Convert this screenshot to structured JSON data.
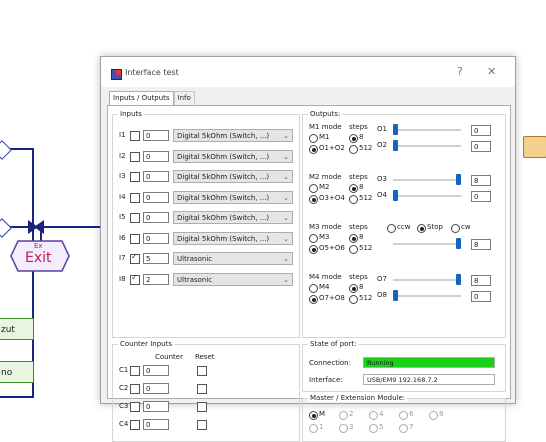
{
  "flow": {
    "exit_small": "Ex",
    "exit_label": "Exit",
    "box1": "zut",
    "box2": "no"
  },
  "window": {
    "title": "Interface test",
    "help": "?",
    "close": "✕"
  },
  "tabs": [
    {
      "label": "Inputs / Outputs"
    },
    {
      "label": "Info"
    }
  ],
  "inputs": {
    "group_label": "Inputs",
    "rows": [
      {
        "name": "I1",
        "checked": false,
        "value": "0",
        "mode": "Digital 5kOhm (Switch, ...)"
      },
      {
        "name": "I2",
        "checked": false,
        "value": "0",
        "mode": "Digital 5kOhm (Switch, ...)"
      },
      {
        "name": "I3",
        "checked": false,
        "value": "0",
        "mode": "Digital 5kOhm (Switch, ...)"
      },
      {
        "name": "I4",
        "checked": false,
        "value": "0",
        "mode": "Digital 5kOhm (Switch, ...)"
      },
      {
        "name": "I5",
        "checked": false,
        "value": "0",
        "mode": "Digital 5kOhm (Switch, ...)"
      },
      {
        "name": "I6",
        "checked": false,
        "value": "0",
        "mode": "Digital 5kOhm (Switch, ...)"
      },
      {
        "name": "I7",
        "checked": true,
        "value": "5",
        "mode": "Ultrasonic"
      },
      {
        "name": "I8",
        "checked": true,
        "value": "2",
        "mode": "Ultrasonic"
      }
    ]
  },
  "outputs": {
    "group_label": "Outputs:",
    "motors": [
      {
        "mode_label": "M1 mode",
        "steps_label": "steps",
        "opt_m": "M1",
        "opt_o": "O1+O2",
        "opt_8": "8",
        "opt_512": "512",
        "outs": [
          {
            "name": "O1",
            "value": "0",
            "level": 0.0
          },
          {
            "name": "O2",
            "value": "0",
            "level": 0.0
          }
        ]
      },
      {
        "mode_label": "M2 mode",
        "steps_label": "steps",
        "opt_m": "M2",
        "opt_o": "O3+O4",
        "opt_8": "8",
        "opt_512": "512",
        "outs": [
          {
            "name": "O3",
            "value": "8",
            "level": 1.0
          },
          {
            "name": "O4",
            "value": "0",
            "level": 0.0
          }
        ]
      },
      {
        "mode_label": "M3 mode",
        "steps_label": "steps",
        "opt_m": "M3",
        "opt_o": "O5+O6",
        "opt_8": "8",
        "opt_512": "512",
        "dir": {
          "ccw": "ccw",
          "stop": "Stop",
          "cw": "cw"
        },
        "outs": [
          {
            "name": "",
            "value": "8",
            "level": 1.0
          }
        ]
      },
      {
        "mode_label": "M4 mode",
        "steps_label": "steps",
        "opt_m": "M4",
        "opt_o": "O7+O8",
        "opt_8": "8",
        "opt_512": "512",
        "outs": [
          {
            "name": "O7",
            "value": "8",
            "level": 1.0
          },
          {
            "name": "O8",
            "value": "0",
            "level": 0.0
          }
        ]
      }
    ]
  },
  "counters": {
    "group_label": "Counter Inputs",
    "col_counter": "Counter",
    "col_reset": "Reset",
    "rows": [
      {
        "name": "C1",
        "value": "0"
      },
      {
        "name": "C2",
        "value": "0"
      },
      {
        "name": "C3",
        "value": "0"
      },
      {
        "name": "C4",
        "value": "0"
      }
    ]
  },
  "state": {
    "group_label": "State of port:",
    "connection_label": "Connection:",
    "connection_value": "Running",
    "interface_label": "Interface:",
    "interface_value": "USB/EM9 192.168.7.2"
  },
  "master": {
    "group_label": "Master / Extension Module:",
    "options": [
      "M",
      "2",
      "4",
      "6",
      "8",
      "1",
      "3",
      "5",
      "7"
    ]
  },
  "colors": {
    "accent": "#1565c0",
    "running": "#19d119",
    "flow_line": "#1a237e",
    "flow_green": "#3a8a2a"
  }
}
